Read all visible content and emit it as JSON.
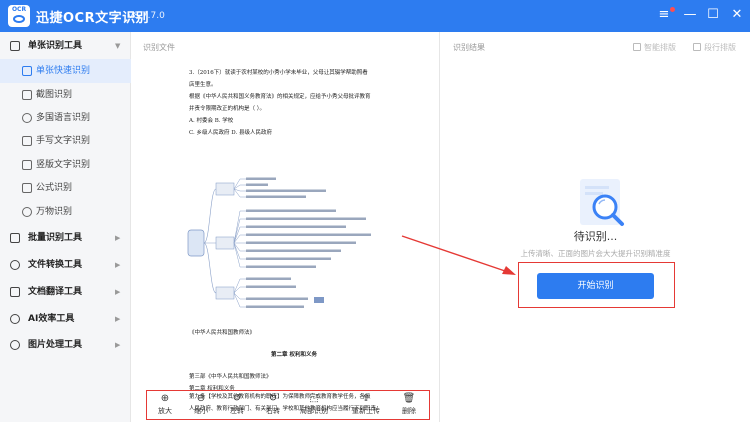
{
  "app": {
    "logo_text": "OCR",
    "title": "迅捷OCR文字识别",
    "version": "v8.7.7.0"
  },
  "window_controls": [
    "menu-icon",
    "minimize-icon",
    "maximize-icon",
    "close-icon"
  ],
  "sidebar": {
    "items": [
      {
        "type": "category",
        "label": "单张识别工具",
        "icon": "document-icon",
        "expanded": true
      },
      {
        "type": "sub",
        "label": "单张快速识别",
        "icon": "file-icon",
        "active": true
      },
      {
        "type": "sub",
        "label": "截图识别",
        "icon": "screenshot-icon"
      },
      {
        "type": "sub",
        "label": "多国语言识别",
        "icon": "globe-icon"
      },
      {
        "type": "sub",
        "label": "手写文字识别",
        "icon": "pen-icon"
      },
      {
        "type": "sub",
        "label": "竖版文字识别",
        "icon": "vertical-text-icon"
      },
      {
        "type": "sub",
        "label": "公式识别",
        "icon": "formula-icon"
      },
      {
        "type": "sub",
        "label": "万物识别",
        "icon": "flower-icon"
      },
      {
        "type": "category",
        "label": "批量识别工具",
        "icon": "batch-icon"
      },
      {
        "type": "category",
        "label": "文件转换工具",
        "icon": "convert-icon"
      },
      {
        "type": "category",
        "label": "文档翻译工具",
        "icon": "translate-icon"
      },
      {
        "type": "category",
        "label": "AI效率工具",
        "icon": "ai-icon"
      },
      {
        "type": "category",
        "label": "图片处理工具",
        "icon": "image-icon"
      }
    ]
  },
  "middle": {
    "label": "识别文件",
    "document": {
      "lines": [
        "3.（2016下）就读于农村某校的小秀小学未毕业，父母让其辍学帮助照看",
        "店里生意。",
        "根据《中华人民共和国义务教育法》的相关规定，应给予小秀父母批评教育",
        "并责令限期改正的机构是（   ）。",
        "A. 村委会                              B. 学校",
        "C. 乡级人民政府                    D. 县级人民政府"
      ],
      "lines_after": [
        "《中华人民共和国教师法》",
        "第二章   权利和义务",
        "第三部《中华人民共和国教师法》",
        "第二章   权利和义务",
        "第九条【学校及其他教育机构的职责】为保障教师完成教育教学任务，各级",
        "人民政府、教育行政部门、有关部门、学校和其他教育机构应当履行下列职责："
      ]
    }
  },
  "toolbar": {
    "items": [
      {
        "label": "放大",
        "icon": "zoom-in-icon",
        "glyph": "⊕"
      },
      {
        "label": "缩小",
        "icon": "zoom-out-icon",
        "glyph": "⊖"
      },
      {
        "label": "左转",
        "icon": "rotate-left-icon",
        "glyph": "↺"
      },
      {
        "label": "右转",
        "icon": "rotate-right-icon",
        "glyph": "↻"
      },
      {
        "label": "局部识别",
        "icon": "crop-icon",
        "glyph": "⬚"
      },
      {
        "label": "重新上传",
        "icon": "upload-icon",
        "glyph": "⇪"
      },
      {
        "label": "删除",
        "icon": "delete-icon",
        "glyph": "🗑"
      }
    ]
  },
  "right": {
    "label": "识别结果",
    "actions": [
      {
        "label": "智能排版",
        "icon": "smart-layout-icon"
      },
      {
        "label": "段行排版",
        "icon": "line-layout-icon"
      }
    ],
    "status": "待识别...",
    "hint": "上传清晰、正面的图片会大大提升识别精准度",
    "start_button": "开始识别"
  },
  "colors": {
    "accent": "#2d7cf0",
    "annotation_red": "#e53935"
  }
}
